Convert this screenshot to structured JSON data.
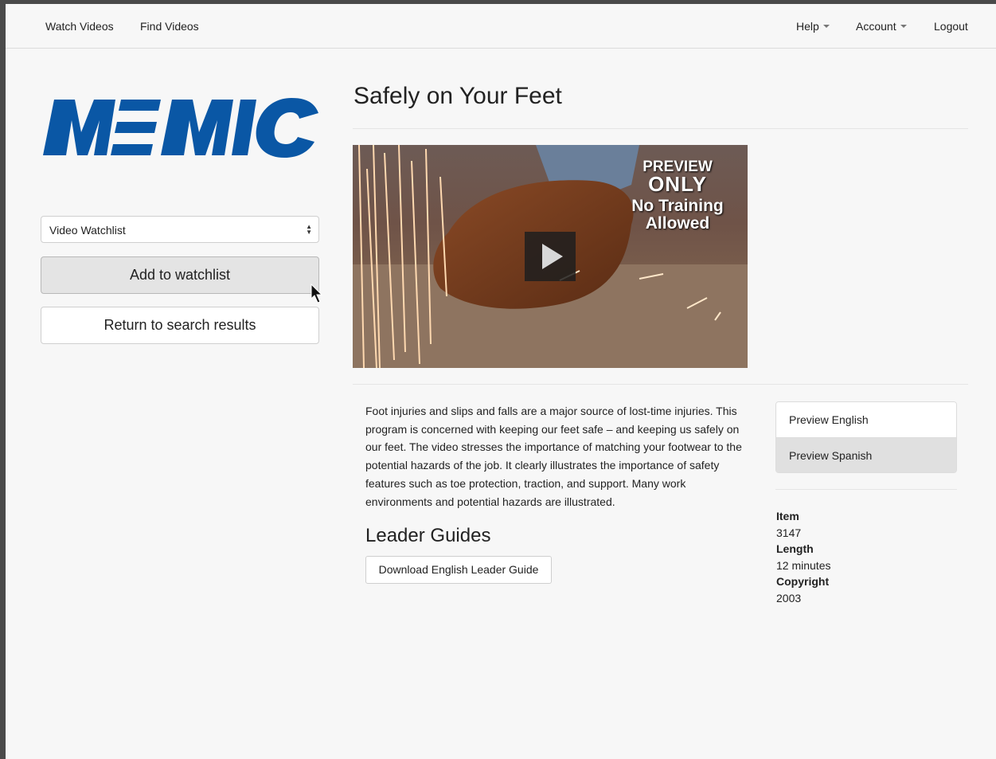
{
  "nav": {
    "watch_videos": "Watch Videos",
    "find_videos": "Find Videos",
    "help": "Help",
    "account": "Account",
    "logout": "Logout"
  },
  "logo": {
    "text": "MEMIC",
    "color": "#0a57a5"
  },
  "sidebar": {
    "watchlist_select": "Video Watchlist",
    "add_button": "Add to watchlist",
    "return_button": "Return to search results"
  },
  "video": {
    "title": "Safely on Your Feet",
    "overlay_line1": "PREVIEW",
    "overlay_line2": "ONLY",
    "overlay_line3": "No Training",
    "overlay_line4": "Allowed"
  },
  "description": "Foot injuries and slips and falls are a major source of lost-time injuries. This program is concerned with keeping our feet safe – and keeping us safely on our feet. The video stresses the importance of matching your footwear to the potential hazards of the job. It clearly illustrates the importance of safety features such as toe protection, traction, and support. Many work environments and potential hazards are illustrated.",
  "leader_guides": {
    "heading": "Leader Guides",
    "download_button": "Download English Leader Guide"
  },
  "preview": {
    "english": "Preview English",
    "spanish": "Preview Spanish"
  },
  "meta": {
    "item_label": "Item",
    "item_value": "3147",
    "length_label": "Length",
    "length_value": "12 minutes",
    "copyright_label": "Copyright",
    "copyright_value": "2003"
  }
}
